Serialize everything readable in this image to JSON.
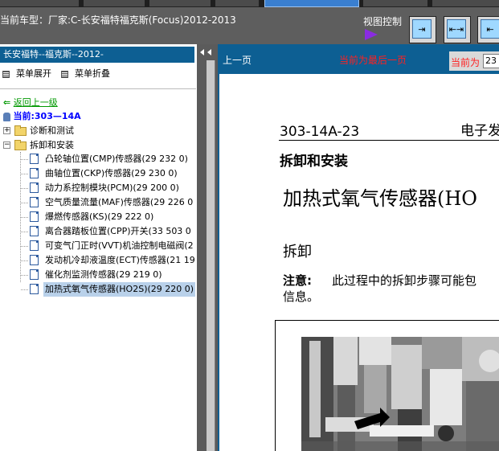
{
  "header": {
    "vehicle_line": "当前车型：厂家:C-长安福特福克斯(Focus)2012-2013",
    "view_control_label": "视图控制"
  },
  "toolbar": {
    "view_buttons": [
      {
        "name": "view-right-icon",
        "glyph": "⇥"
      },
      {
        "name": "view-center-icon",
        "glyph": "⇤⇥"
      },
      {
        "name": "view-left-icon",
        "glyph": "⇤"
      }
    ]
  },
  "left_panel": {
    "header": "长安福特--福克斯--2012-",
    "expand_menu": "菜单展开",
    "collapse_menu": "菜单折叠",
    "back": "返回上一级",
    "current": "当前:303—14A",
    "folders": [
      {
        "label": "诊断和测试",
        "expanded": false
      },
      {
        "label": "拆卸和安装",
        "expanded": true
      }
    ],
    "items": [
      "凸轮轴位置(CMP)传感器(29 232 0)",
      "曲轴位置(CKP)传感器(29 230 0)",
      "动力系控制模块(PCM)(29 200 0)",
      "空气质量流量(MAF)传感器(29 226 0",
      "爆燃传感器(KS)(29 222 0)",
      "离合器踏板位置(CPP)开关(33 503 0",
      "可变气门正时(VVT)机油控制电磁阀(2",
      "发动机冷却液温度(ECT)传感器(21 19",
      "催化剂监测传感器(29 219 0)",
      "加热式氧气传感器(HO2S)(29 220 0)"
    ],
    "selected_index": 9
  },
  "nav": {
    "prev": "上一页",
    "last_page_notice": "当前为最后一页",
    "current_label": "当前为",
    "page_value": "23"
  },
  "document": {
    "code": "303-14A-23",
    "header_right": "电子发",
    "subtitle": "拆卸和安装",
    "title": "加热式氧气传感器(HO",
    "section": "拆卸",
    "note_label": "注意:",
    "note_text_1": "此过程中的拆卸步骤可能包",
    "note_text_2": "信息。"
  },
  "colors": {
    "panel_blue": "#0d5f93",
    "link_green": "#009900",
    "current_blue": "#0000ff",
    "alert_red": "#ff2020"
  }
}
